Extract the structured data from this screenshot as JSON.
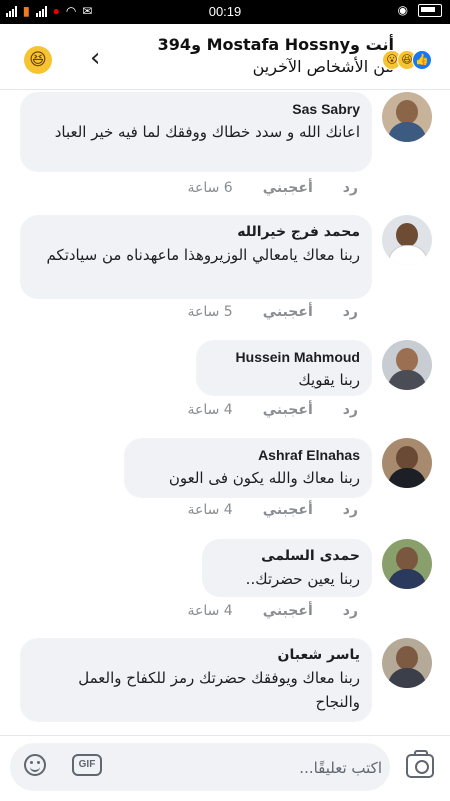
{
  "status_bar": {
    "time": "00:19",
    "battery_icon": "battery-icon",
    "eye_icon": "eye-icon"
  },
  "header": {
    "title": "أنت وMostafa Hossny و394",
    "subtitle": "من الأشخاص الآخرين",
    "back_icon": "chevron-left-icon",
    "reactions": [
      "like-icon",
      "haha-icon",
      "wow-icon"
    ]
  },
  "actions": {
    "like": "أعجبني",
    "reply": "رد"
  },
  "comments": [
    {
      "name": "Sas Sabry",
      "text": "اعانك الله و سدد خطاك ووفقك لما فيه خير العباد",
      "time": "6 ساعة"
    },
    {
      "name": "محمد فرج خيرالله",
      "text": "ربنا معاك يامعالي الوزيروهذا ماعهدناه من سيادتكم",
      "time": "5 ساعة"
    },
    {
      "name": "Hussein Mahmoud",
      "text": "ربنا يقويك",
      "time": "4 ساعة"
    },
    {
      "name": "Ashraf Elnahas",
      "text": "ربنا معاك والله يكون فى العون",
      "time": "4 ساعة"
    },
    {
      "name": "حمدى السلمى",
      "text": "ربنا يعين حضرتك..",
      "time": "4 ساعة"
    },
    {
      "name": "ياسر شعبان",
      "text": "ربنا معاك ويوفقك حضرتك رمز للكفاح والعمل والنجاح",
      "time": ""
    }
  ],
  "compose": {
    "placeholder": "اكتب تعليقًا..."
  },
  "colors": {
    "bubble": "#f0f2f5",
    "meta_text": "#8a8d91",
    "like_blue": "#1877f2"
  }
}
